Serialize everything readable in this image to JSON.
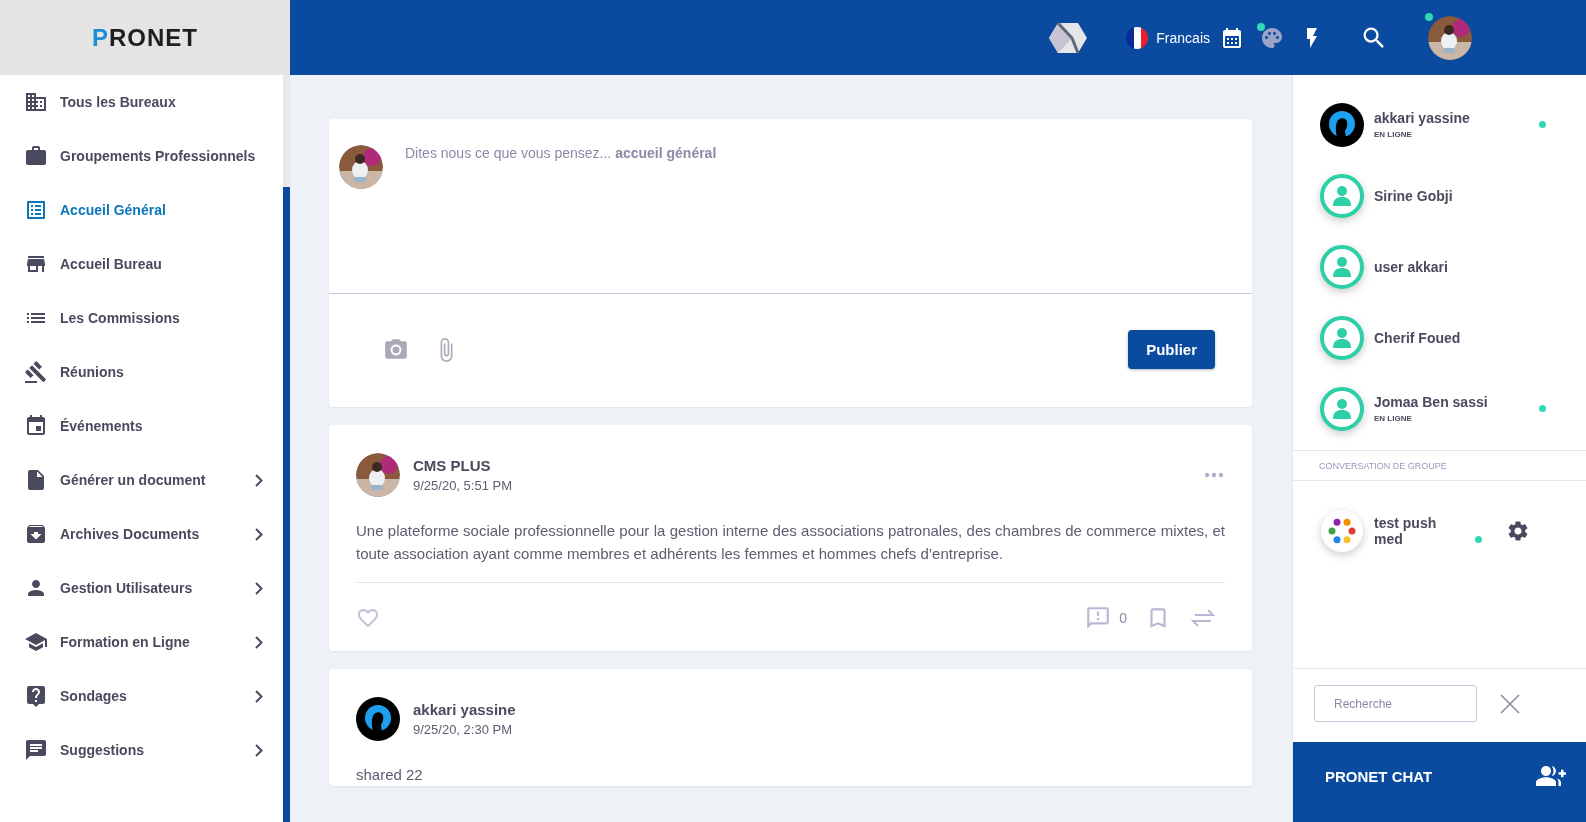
{
  "logo": "PRONET",
  "sidebar": {
    "items": [
      {
        "label": "Tous les Bureaux",
        "selected": false,
        "has_submenu": false
      },
      {
        "label": "Groupements Professionnels",
        "selected": false,
        "has_submenu": false
      },
      {
        "label": "Accueil Général",
        "selected": true,
        "has_submenu": false
      },
      {
        "label": "Accueil Bureau",
        "selected": false,
        "has_submenu": false
      },
      {
        "label": "Les Commissions",
        "selected": false,
        "has_submenu": false
      },
      {
        "label": "Réunions",
        "selected": false,
        "has_submenu": false
      },
      {
        "label": "Événements",
        "selected": false,
        "has_submenu": false
      },
      {
        "label": "Générer un document",
        "selected": false,
        "has_submenu": true
      },
      {
        "label": "Archives Documents",
        "selected": false,
        "has_submenu": true
      },
      {
        "label": "Gestion Utilisateurs",
        "selected": false,
        "has_submenu": true
      },
      {
        "label": "Formation en Ligne",
        "selected": false,
        "has_submenu": true
      },
      {
        "label": "Sondages",
        "selected": false,
        "has_submenu": true
      },
      {
        "label": "Suggestions",
        "selected": false,
        "has_submenu": true
      }
    ]
  },
  "header": {
    "language": "Francais",
    "palette_badge": true,
    "avatar_badge": true
  },
  "composer": {
    "placeholder": "Dites nous ce que vous pensez... **accueil général**",
    "button": "Publier"
  },
  "posts": [
    {
      "author": "CMS PLUS",
      "time": "9/25/20, 5:51 PM",
      "text": "Une plateforme sociale professionnelle pour la gestion interne des associations patronales, des chambres de commerce mixtes, et toute association ayant comme membres et adhérents les femmes et hommes chefs d’entreprise.",
      "comments": "0",
      "show_actions": true
    },
    {
      "avatar": {
        "kind": "dark"
      },
      "author": "akkari yassine",
      "time": "9/25/20, 2:30 PM",
      "text": "shared 22",
      "show_actions": false
    }
  ],
  "chat": {
    "contacts": [
      {
        "name": "akkari yassine",
        "avatar": {
          "kind": "dark"
        },
        "status": "EN LIGNE",
        "online": true
      },
      {
        "name": "Sirine Gobji",
        "avatar": {
          "kind": "default"
        },
        "online": false
      },
      {
        "name": "user akkari",
        "avatar": {
          "kind": "default"
        },
        "online": false
      },
      {
        "name": "Cherif Foued",
        "avatar": {
          "kind": "default"
        },
        "online": false
      },
      {
        "name": "Jomaa Ben sassi",
        "avatar": {
          "kind": "default"
        },
        "status": "EN LIGNE",
        "online": true
      }
    ],
    "group_heading": "CONVERSATION DE GROUPE",
    "groups": [
      {
        "name": "test push med",
        "online": true
      }
    ],
    "search": {
      "placeholder": "Recherche"
    },
    "footer": "PRONET CHAT"
  }
}
